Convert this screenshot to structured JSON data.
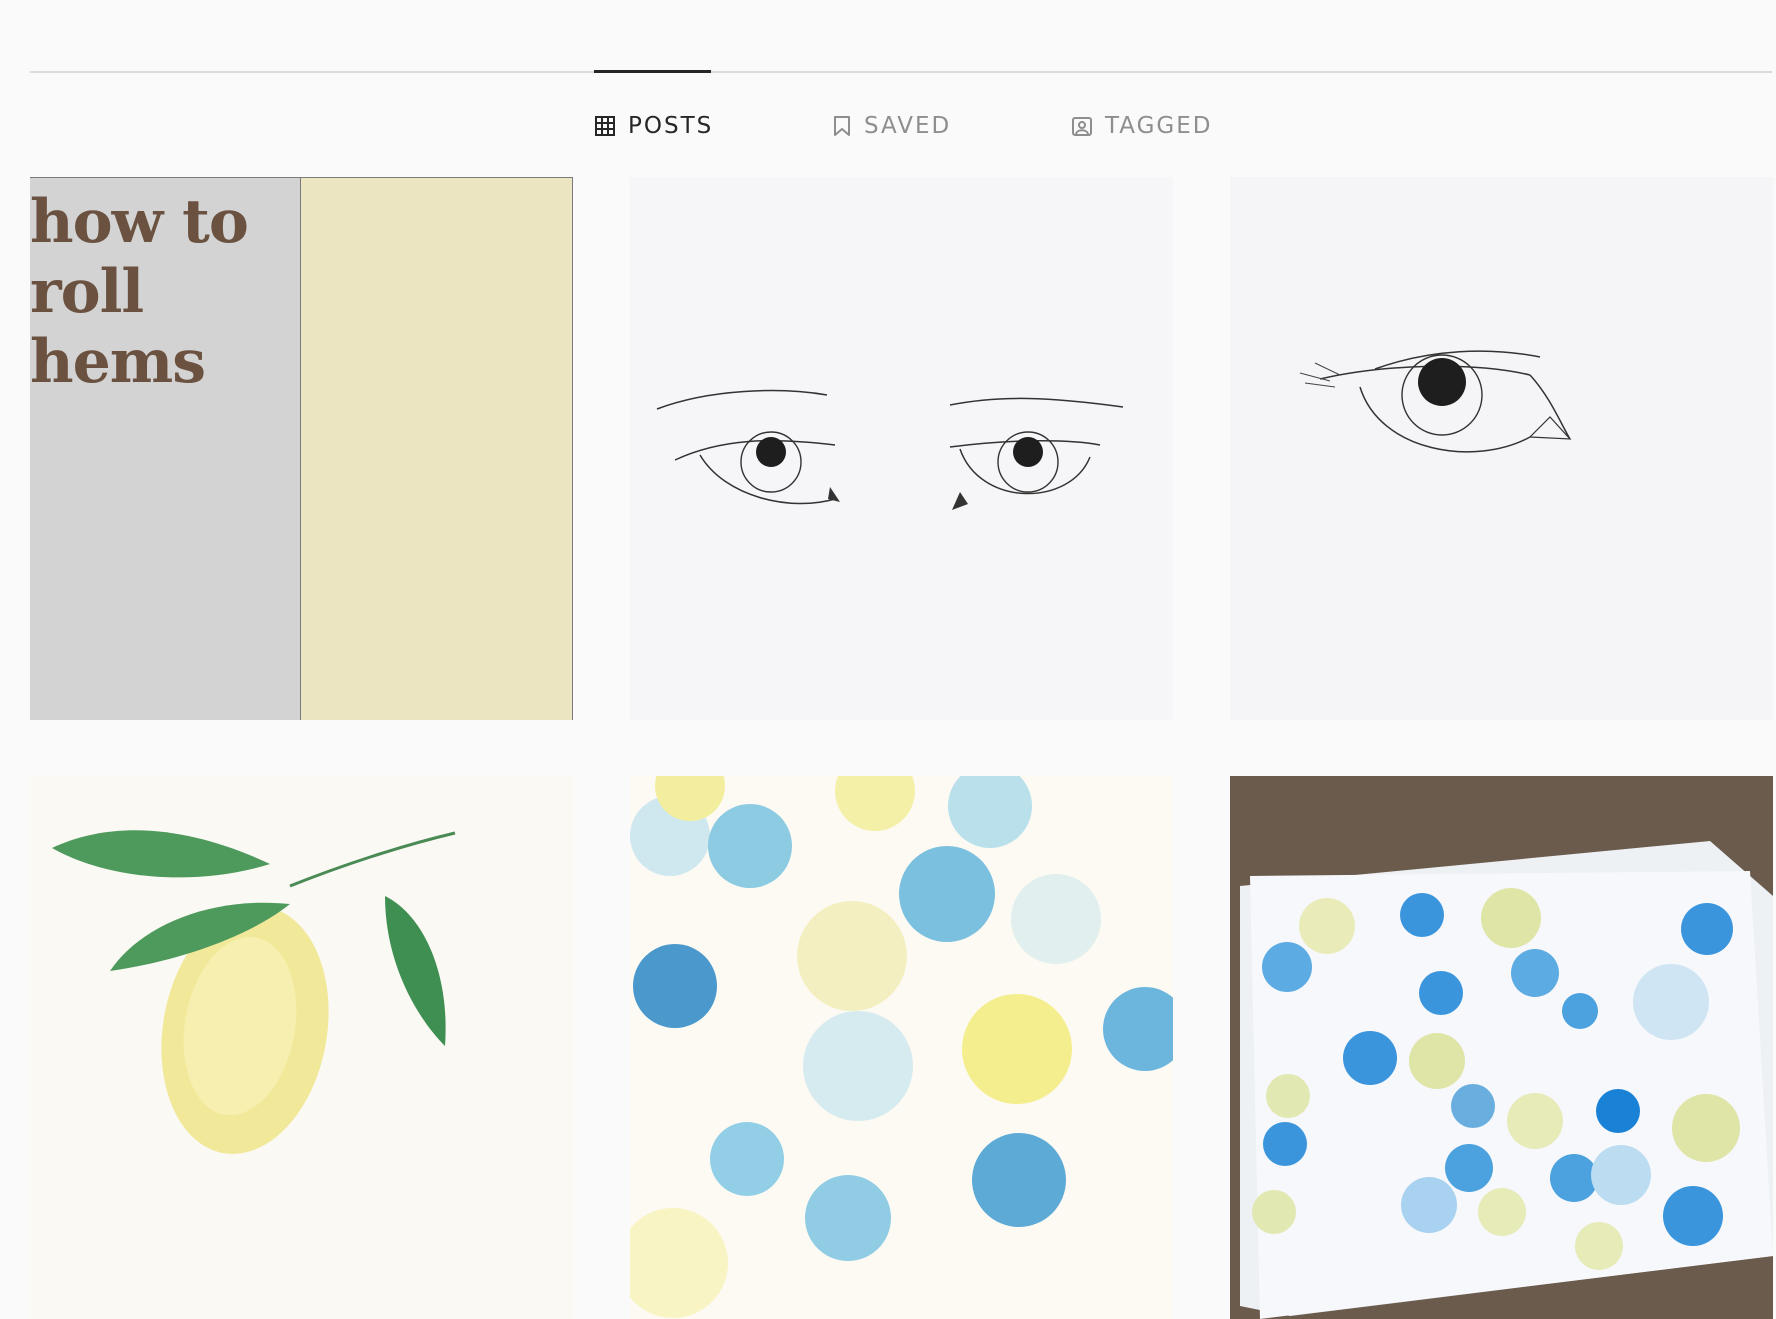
{
  "tabs": [
    {
      "label": "POSTS",
      "icon": "grid-icon",
      "active": true
    },
    {
      "label": "SAVED",
      "icon": "bookmark-icon",
      "active": false
    },
    {
      "label": "TAGGED",
      "icon": "tagged-person-icon",
      "active": false
    }
  ],
  "posts": [
    {
      "caption_lines": [
        "how to",
        "roll",
        "hems"
      ]
    },
    {},
    {},
    {},
    {},
    {}
  ],
  "colors": {
    "active_text": "#262626",
    "inactive_text": "#8e8e8e",
    "hem_text": "#6b5140",
    "hem_grey": "#d3d3d3",
    "hem_yellow": "#ece5c2"
  }
}
